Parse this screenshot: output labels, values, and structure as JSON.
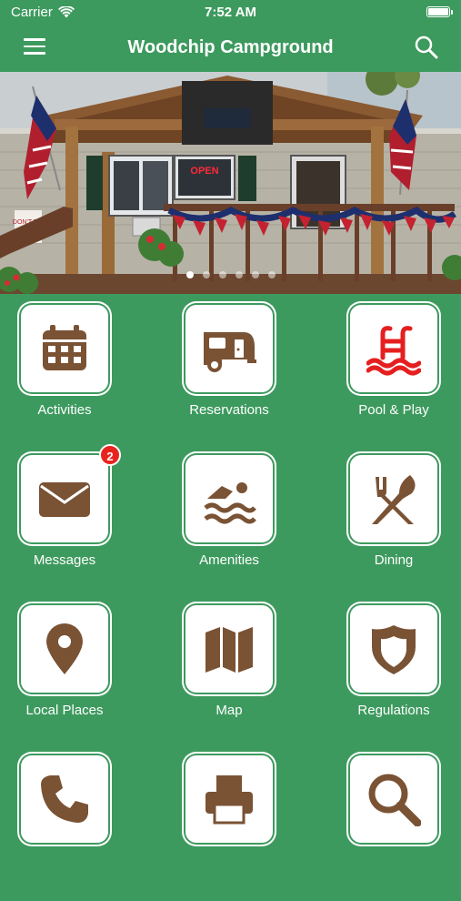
{
  "status": {
    "carrier": "Carrier",
    "time": "7:52 AM"
  },
  "nav": {
    "title": "Woodchip Campground"
  },
  "hero": {
    "slide_count": 6,
    "active_slide": 1,
    "sign_text": "OPEN",
    "poster_text": "DON'T THI"
  },
  "colors": {
    "background": "#3d9a5e",
    "icon_brown": "#7a5234",
    "pool_red": "#e51f1f",
    "badge_red": "#e8231e"
  },
  "tiles": [
    {
      "label": "Activities",
      "icon": "calendar-icon"
    },
    {
      "label": "Reservations",
      "icon": "camper-trailer-icon"
    },
    {
      "label": "Pool & Play",
      "icon": "pool-icon"
    },
    {
      "label": "Messages",
      "icon": "envelope-icon",
      "badge": "2"
    },
    {
      "label": "Amenities",
      "icon": "swimmer-icon"
    },
    {
      "label": "Dining",
      "icon": "utensils-icon"
    },
    {
      "label": "Local Places",
      "icon": "map-pin-icon"
    },
    {
      "label": "Map",
      "icon": "folded-map-icon"
    },
    {
      "label": "Regulations",
      "icon": "shield-icon"
    },
    {
      "label": "",
      "icon": "phone-icon"
    },
    {
      "label": "",
      "icon": "printer-icon"
    },
    {
      "label": "",
      "icon": "magnifier-icon"
    }
  ]
}
